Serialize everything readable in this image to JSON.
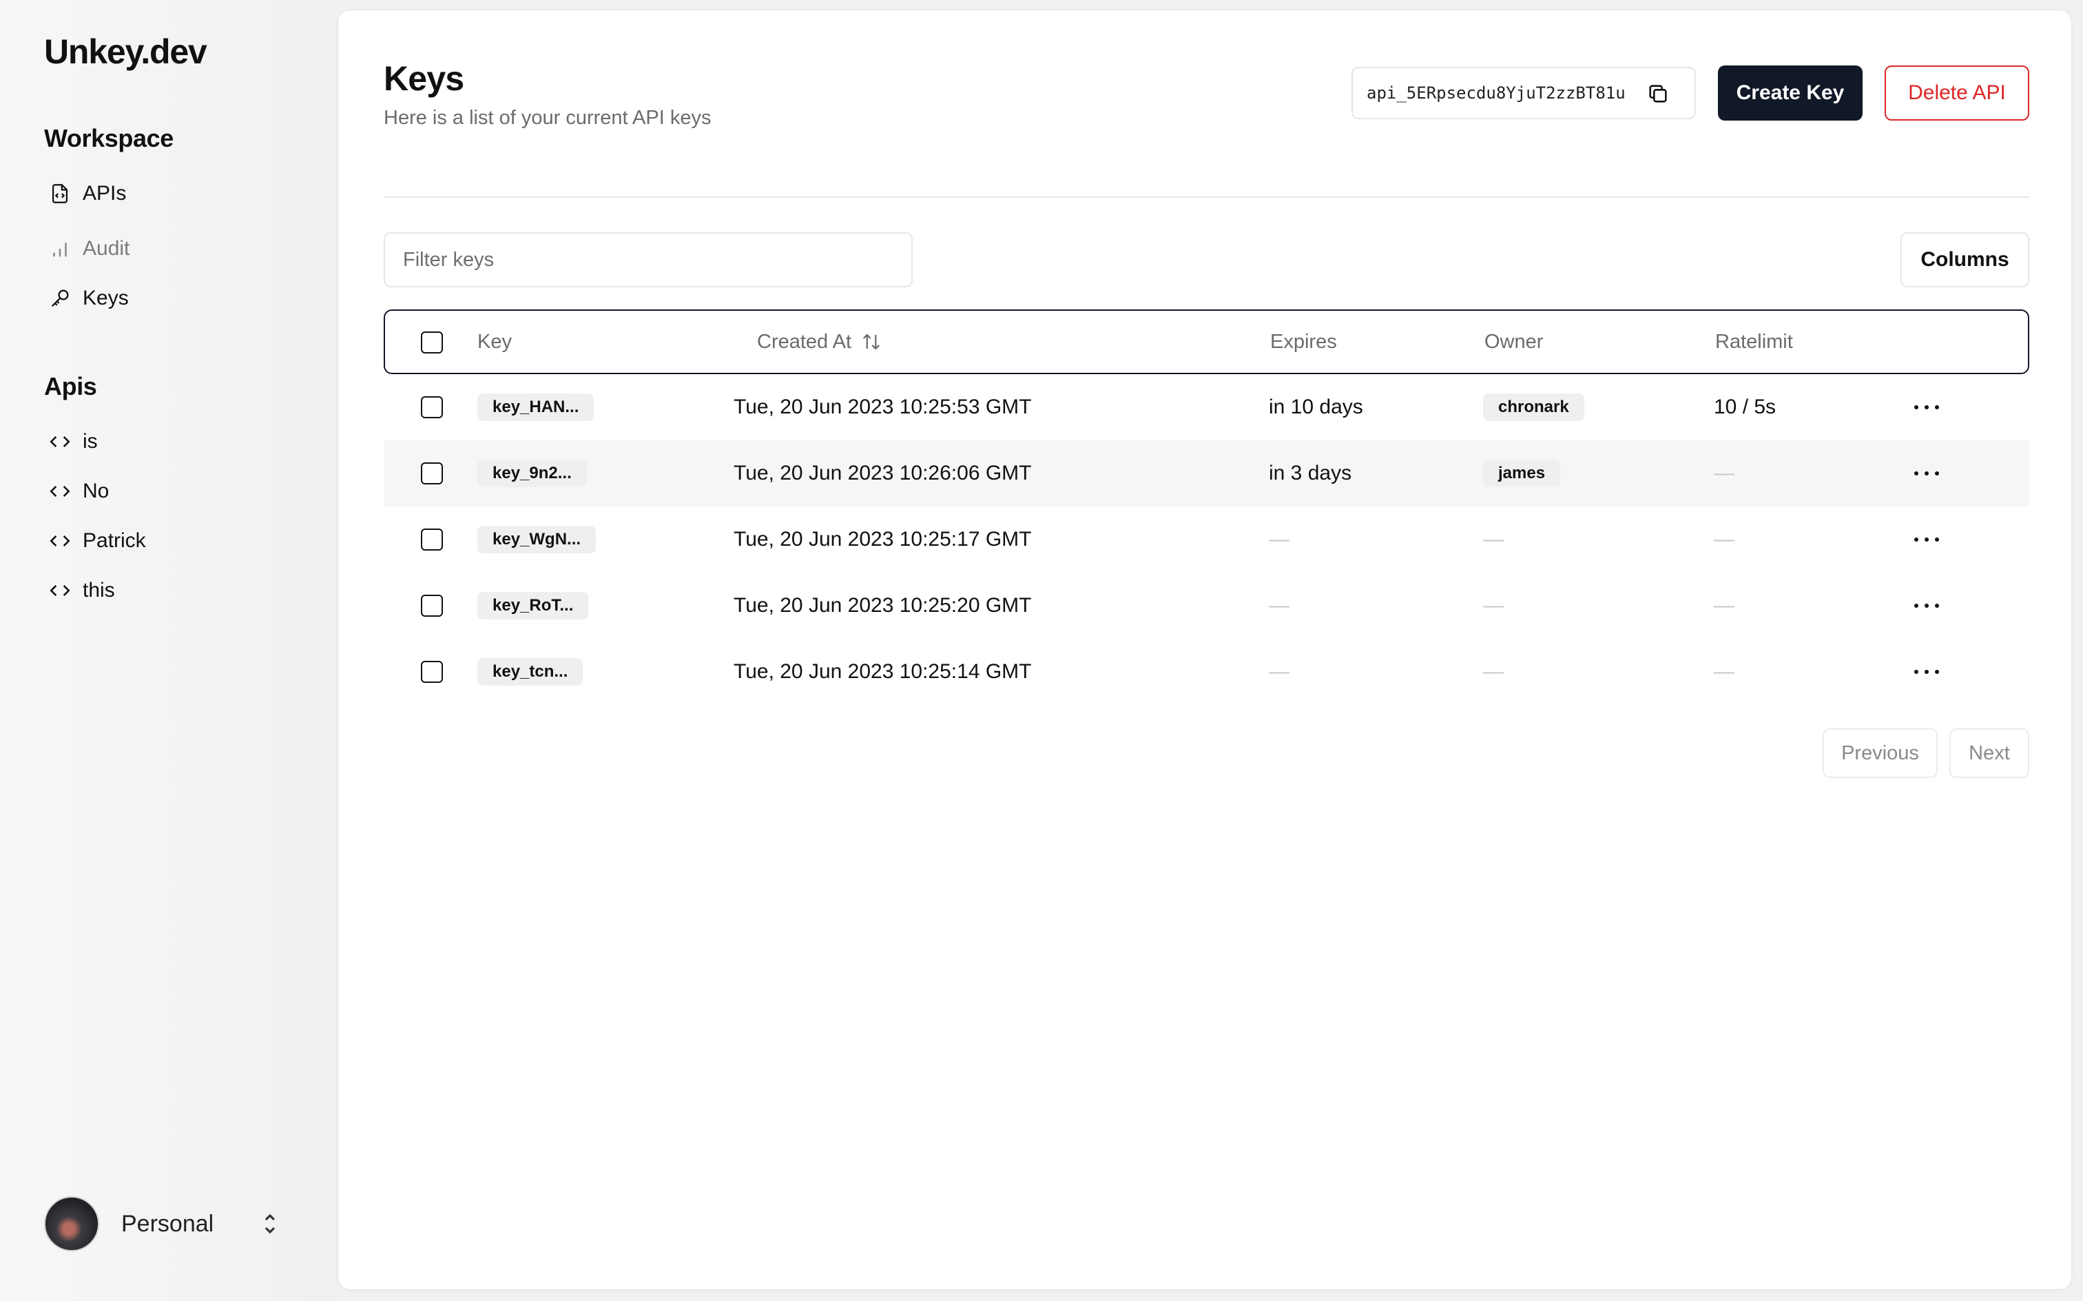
{
  "sidebar": {
    "brand": "Unkey.dev",
    "workspace_title": "Workspace",
    "workspace_items": [
      {
        "label": "APIs",
        "icon": "file-code-icon"
      },
      {
        "label": "Audit",
        "icon": "bar-chart-icon"
      },
      {
        "label": "Keys",
        "icon": "key-icon"
      }
    ],
    "apis_title": "Apis",
    "api_items": [
      {
        "label": "is",
        "icon": "code-icon"
      },
      {
        "label": "No",
        "icon": "code-icon"
      },
      {
        "label": "Patrick",
        "icon": "code-icon"
      },
      {
        "label": "this",
        "icon": "code-icon"
      }
    ],
    "profile": {
      "name": "Personal"
    }
  },
  "header": {
    "title": "Keys",
    "subtitle": "Here is a list of your current API keys",
    "api_id": "api_5ERpsecdu8YjuT2zzBT81u",
    "create_key_label": "Create Key",
    "delete_api_label": "Delete API"
  },
  "toolbar": {
    "filter_placeholder": "Filter keys",
    "columns_label": "Columns"
  },
  "table": {
    "columns": [
      "Key",
      "Created At",
      "Expires",
      "Owner",
      "Ratelimit"
    ],
    "rows": [
      {
        "key": "key_HAN...",
        "created_at": "Tue, 20 Jun 2023 10:25:53 GMT",
        "expires": "in 10 days",
        "owner": "chronark",
        "ratelimit": "10 / 5s"
      },
      {
        "key": "key_9n2...",
        "created_at": "Tue, 20 Jun 2023 10:26:06 GMT",
        "expires": "in 3 days",
        "owner": "james",
        "ratelimit": "—"
      },
      {
        "key": "key_WgN...",
        "created_at": "Tue, 20 Jun 2023 10:25:17 GMT",
        "expires": "—",
        "owner": "—",
        "ratelimit": "—"
      },
      {
        "key": "key_RoT...",
        "created_at": "Tue, 20 Jun 2023 10:25:20 GMT",
        "expires": "—",
        "owner": "—",
        "ratelimit": "—"
      },
      {
        "key": "key_tcn...",
        "created_at": "Tue, 20 Jun 2023 10:25:14 GMT",
        "expires": "—",
        "owner": "—",
        "ratelimit": "—"
      }
    ]
  },
  "pagination": {
    "previous_label": "Previous",
    "next_label": "Next"
  },
  "colors": {
    "primary": "#111827",
    "danger": "#dc2626",
    "muted_text": "#6b6b6b"
  }
}
